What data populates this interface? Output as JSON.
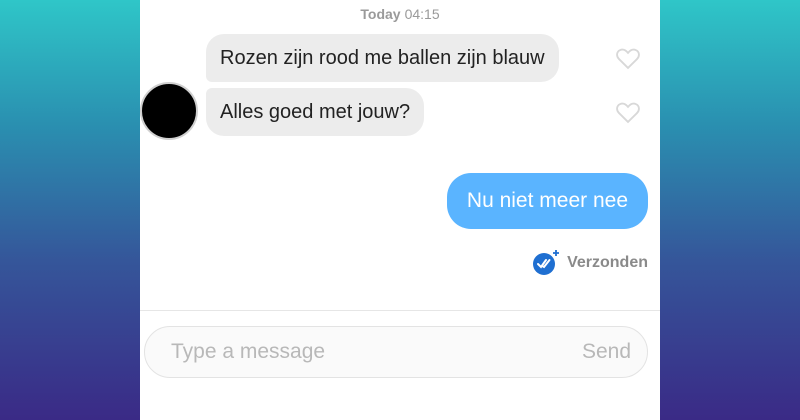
{
  "header": {
    "day": "Today",
    "time": "04:15"
  },
  "messages": [
    {
      "text": "Rozen zijn rood me ballen zijn blauw",
      "direction": "incoming"
    },
    {
      "text": "Alles goed met jouw?",
      "direction": "incoming"
    },
    {
      "text": "Nu niet meer nee",
      "direction": "outgoing"
    }
  ],
  "status": {
    "label": "Verzonden",
    "icon": "double-check-icon"
  },
  "composer": {
    "placeholder": "Type a message",
    "value": "",
    "send_label": "Send"
  },
  "colors": {
    "outgoing_bubble": "#5ab4ff",
    "incoming_bubble": "#ececec",
    "status_icon": "#1f6fd1"
  }
}
